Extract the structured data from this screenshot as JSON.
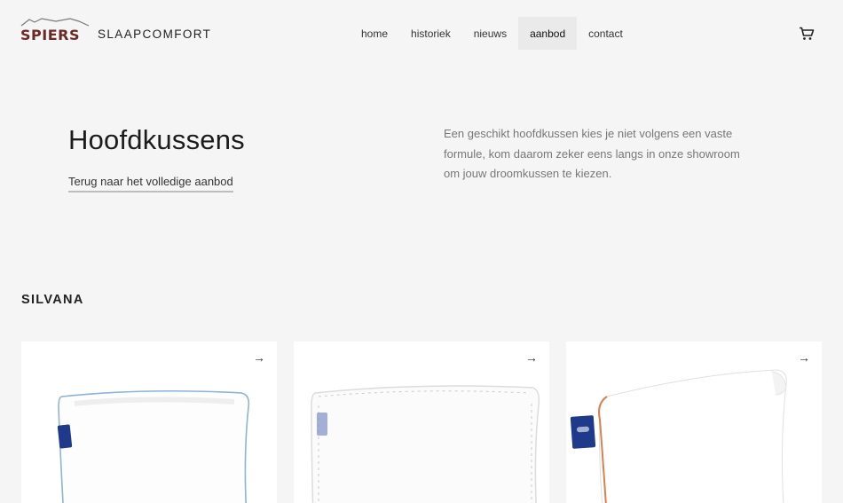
{
  "brand": {
    "name": "SPIERS",
    "sub": "SLAAPCOMFORT",
    "color": "#6b2a23"
  },
  "nav": {
    "items": [
      {
        "label": "home"
      },
      {
        "label": "historiek"
      },
      {
        "label": "nieuws"
      },
      {
        "label": "aanbod",
        "active": true
      },
      {
        "label": "contact"
      }
    ],
    "cart_icon": "cart-icon"
  },
  "hero": {
    "title": "Hoofdkussens",
    "back_link": "Terug naar het volledige aanbod",
    "description": "Een geschikt hoofdkussen kies je niet volgens een vaste formule, kom daarom zeker eens langs in onze showroom om jouw droomkussen te kiezen."
  },
  "section": {
    "title": "SILVANA"
  },
  "products": [
    {
      "arrow": "→",
      "image": "white-pillow-blue-piping"
    },
    {
      "arrow": "→",
      "image": "white-pillow-quilted-edge"
    },
    {
      "arrow": "→",
      "image": "ergonomic-pillow-orange-piping"
    }
  ]
}
